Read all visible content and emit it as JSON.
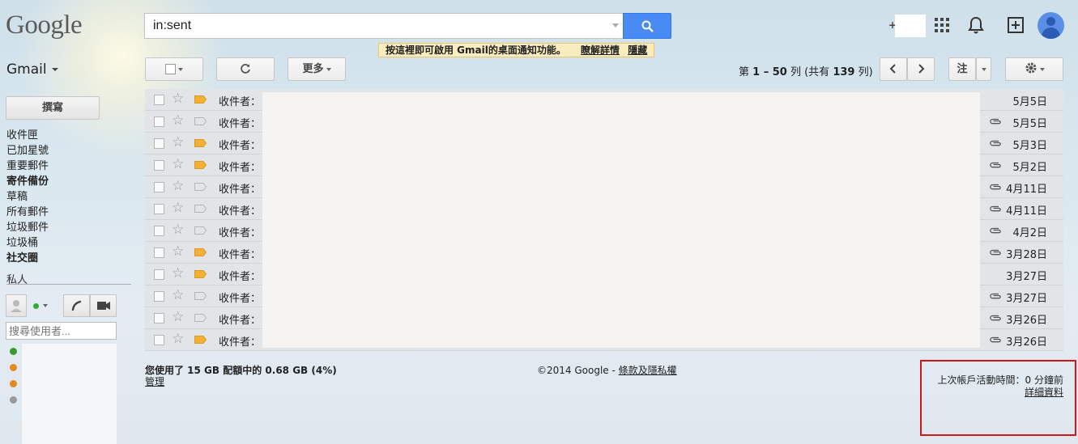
{
  "header": {
    "logo": "Google",
    "search_value": "in:sent",
    "notification_text": "按這裡即可啟用 Gmail的桌面通知功能。",
    "notification_learn_more": "瞭解詳情",
    "notification_hide": "隱藏",
    "plus_label": "+"
  },
  "toolbar": {
    "gmail_label": "Gmail",
    "more_label": "更多",
    "pager_prefix": "第 ",
    "pager_range": "1 – 50",
    "pager_mid": " 列 (共有 ",
    "pager_total": "139",
    "pager_suffix": " 列)",
    "input_tools_label": "注"
  },
  "sidebar": {
    "compose_label": "撰寫",
    "items": [
      {
        "label": "收件匣",
        "bold": false
      },
      {
        "label": "已加星號",
        "bold": false
      },
      {
        "label": "重要郵件",
        "bold": false
      },
      {
        "label": "寄件備份",
        "bold": true
      },
      {
        "label": "草稿",
        "bold": false
      },
      {
        "label": "所有郵件",
        "bold": false
      },
      {
        "label": "垃圾郵件",
        "bold": false
      },
      {
        "label": "垃圾桶",
        "bold": false
      },
      {
        "label": "社交圈",
        "bold": true
      }
    ],
    "private_label": "私人",
    "people_search_placeholder": "搜尋使用者..."
  },
  "mail_rows": [
    {
      "sender": "收件者：",
      "label_color": "#f2b134",
      "attachment": false,
      "date": "5月5日"
    },
    {
      "sender": "收件者：",
      "label_color": "none",
      "attachment": true,
      "date": "5月5日"
    },
    {
      "sender": "收件者：",
      "label_color": "#f2b134",
      "attachment": true,
      "date": "5月3日"
    },
    {
      "sender": "收件者：",
      "label_color": "#f2b134",
      "attachment": true,
      "date": "5月2日"
    },
    {
      "sender": "收件者：",
      "label_color": "none",
      "attachment": true,
      "date": "4月11日"
    },
    {
      "sender": "收件者：",
      "label_color": "none",
      "attachment": true,
      "date": "4月11日"
    },
    {
      "sender": "收件者：",
      "label_color": "none",
      "attachment": true,
      "date": "4月2日"
    },
    {
      "sender": "收件者：",
      "label_color": "#f2b134",
      "attachment": true,
      "date": "3月28日"
    },
    {
      "sender": "收件者：",
      "label_color": "#f2b134",
      "attachment": false,
      "date": "3月27日"
    },
    {
      "sender": "收件者：",
      "label_color": "none",
      "attachment": true,
      "date": "3月27日"
    },
    {
      "sender": "收件者：",
      "label_color": "none",
      "attachment": true,
      "date": "3月26日"
    },
    {
      "sender": "收件者：",
      "label_color": "#f2b134",
      "attachment": true,
      "date": "3月26日"
    }
  ],
  "footer": {
    "storage_text": "您使用了 15 GB 配額中的 0.68 GB (4%)",
    "manage_label": "管理",
    "copyright_prefix": "©2014 Google - ",
    "terms_label": "條款及隱私權",
    "last_activity": "上次帳戶活動時間：0 分鐘前",
    "details_label": "詳細資料"
  },
  "colors": {
    "accent_blue": "#4a8af4",
    "highlight_red": "#d0161a",
    "label_yellow": "#f2b134"
  }
}
